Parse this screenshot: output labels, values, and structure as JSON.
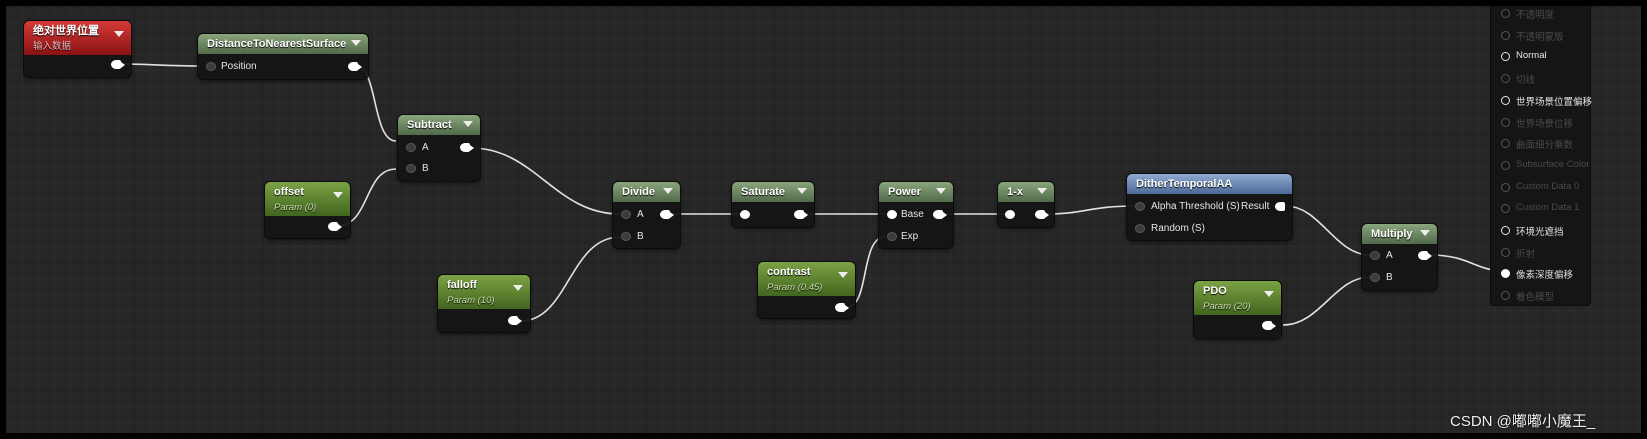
{
  "nodes": {
    "world_position": {
      "title": "绝对世界位置",
      "subtitle": "输入数据"
    },
    "distance": {
      "title": "DistanceToNearestSurface",
      "pin_position": "Position"
    },
    "subtract": {
      "title": "Subtract",
      "pin_a": "A",
      "pin_b": "B"
    },
    "offset": {
      "title": "offset",
      "subtitle": "Param (0)"
    },
    "divide": {
      "title": "Divide",
      "pin_a": "A",
      "pin_b": "B"
    },
    "falloff": {
      "title": "falloff",
      "subtitle": "Param (10)"
    },
    "saturate": {
      "title": "Saturate"
    },
    "power": {
      "title": "Power",
      "pin_base": "Base",
      "pin_exp": "Exp"
    },
    "contrast": {
      "title": "contrast",
      "subtitle": "Param (0.45)"
    },
    "one_minus": {
      "title": "1-x"
    },
    "dither": {
      "title": "DitherTemporalAA",
      "pin_alpha": "Alpha Threshold (S)",
      "pin_result": "Result",
      "pin_random": "Random (S)"
    },
    "multiply": {
      "title": "Multiply",
      "pin_a": "A",
      "pin_b": "B"
    },
    "pdo": {
      "title": "PDO",
      "subtitle": "Param (20)"
    }
  },
  "result_panel": {
    "items": [
      {
        "label": "不透明度",
        "state": "dim"
      },
      {
        "label": "不透明蒙版",
        "state": "dim"
      },
      {
        "label": "Normal",
        "state": "on"
      },
      {
        "label": "切线",
        "state": "dim"
      },
      {
        "label": "世界场景位置偏移",
        "state": "on"
      },
      {
        "label": "世界场景位移",
        "state": "dim"
      },
      {
        "label": "曲面细分乘数",
        "state": "dim"
      },
      {
        "label": "Subsurface Color",
        "state": "dim"
      },
      {
        "label": "Custom Data 0",
        "state": "dim"
      },
      {
        "label": "Custom Data 1",
        "state": "dim"
      },
      {
        "label": "环境光遮挡",
        "state": "on"
      },
      {
        "label": "折射",
        "state": "dim"
      },
      {
        "label": "像素深度偏移",
        "state": "filled"
      },
      {
        "label": "着色模型",
        "state": "dim"
      }
    ]
  },
  "watermark": "CSDN @嘟嘟小魔王_"
}
